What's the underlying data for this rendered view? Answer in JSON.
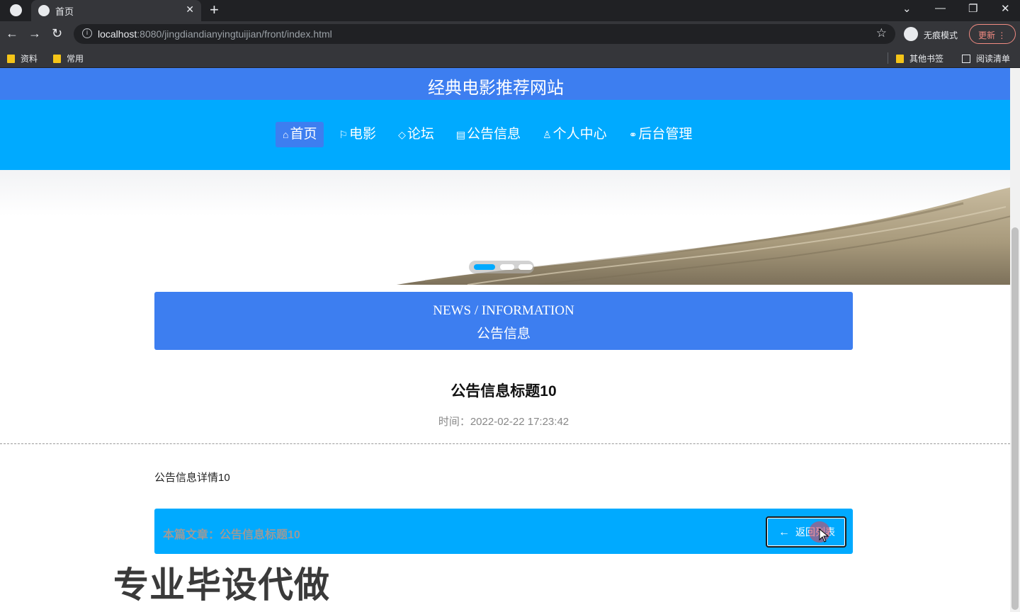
{
  "browser": {
    "tab_title": "首页",
    "tab_close": "✕",
    "new_tab": "+",
    "url_host": "localhost",
    "url_rest": ":8080/jingdiandianyingtuijian/front/index.html",
    "incognito_label": "无痕模式",
    "update_label": "更新",
    "bookmarks": [
      {
        "label": "资料",
        "icon": "folder-icon"
      },
      {
        "label": "常用",
        "icon": "folder-icon"
      }
    ],
    "other_bookmarks": "其他书签",
    "reading_list": "阅读清单"
  },
  "site": {
    "title": "经典电影推荐网站",
    "nav": [
      {
        "label": "首页",
        "icon": "home-icon",
        "glyph": "⌂",
        "active": true
      },
      {
        "label": "电影",
        "icon": "flag-icon",
        "glyph": "⚐",
        "active": false
      },
      {
        "label": "论坛",
        "icon": "tag-icon",
        "glyph": "◇",
        "active": false
      },
      {
        "label": "公告信息",
        "icon": "notice-icon",
        "glyph": "▤",
        "active": false
      },
      {
        "label": "个人中心",
        "icon": "user-icon",
        "glyph": "♙",
        "active": false
      },
      {
        "label": "后台管理",
        "icon": "link-icon",
        "glyph": "⚭",
        "active": false
      }
    ],
    "carousel": {
      "slides": 3,
      "active_index": 0
    }
  },
  "section": {
    "title_en": "NEWS / INFORMATION",
    "title_cn": "公告信息"
  },
  "article": {
    "title": "公告信息标题10",
    "time": "时间：2022-02-22 17:23:42",
    "body": "公告信息详情10",
    "current_label": "本篇文章：公告信息标题10",
    "back_label": "返回列表"
  },
  "watermark": "专业毕设代做",
  "colors": {
    "header_blue": "#00aaff",
    "accent_blue": "#3d7ef0"
  }
}
